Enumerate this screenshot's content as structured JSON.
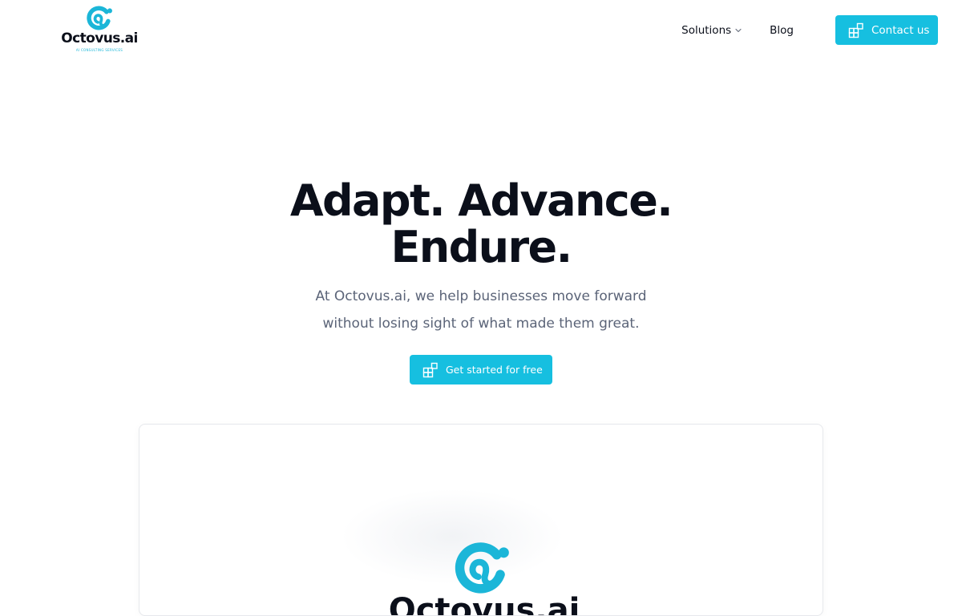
{
  "brand": {
    "name": "Octovus.ai",
    "tagline": "AI CONSULTING SERVICES",
    "accent_color": "#16bfe0",
    "logo_icon": "octovus-logo-icon"
  },
  "nav": {
    "solutions_label": "Solutions",
    "solutions_icon": "chevron-down-icon",
    "blog_label": "Blog",
    "contact_label": "Contact us",
    "contact_icon": "squares-icon"
  },
  "hero": {
    "title_line1": "Adapt. Advance.",
    "title_line2": "Endure.",
    "subtitle_line1": "At Octovus.ai, we help businesses move forward",
    "subtitle_line2": "without losing sight of what made them great.",
    "cta_label": "Get started for free",
    "cta_icon": "squares-icon"
  },
  "preview": {
    "logo_icon": "octovus-logo-icon"
  }
}
